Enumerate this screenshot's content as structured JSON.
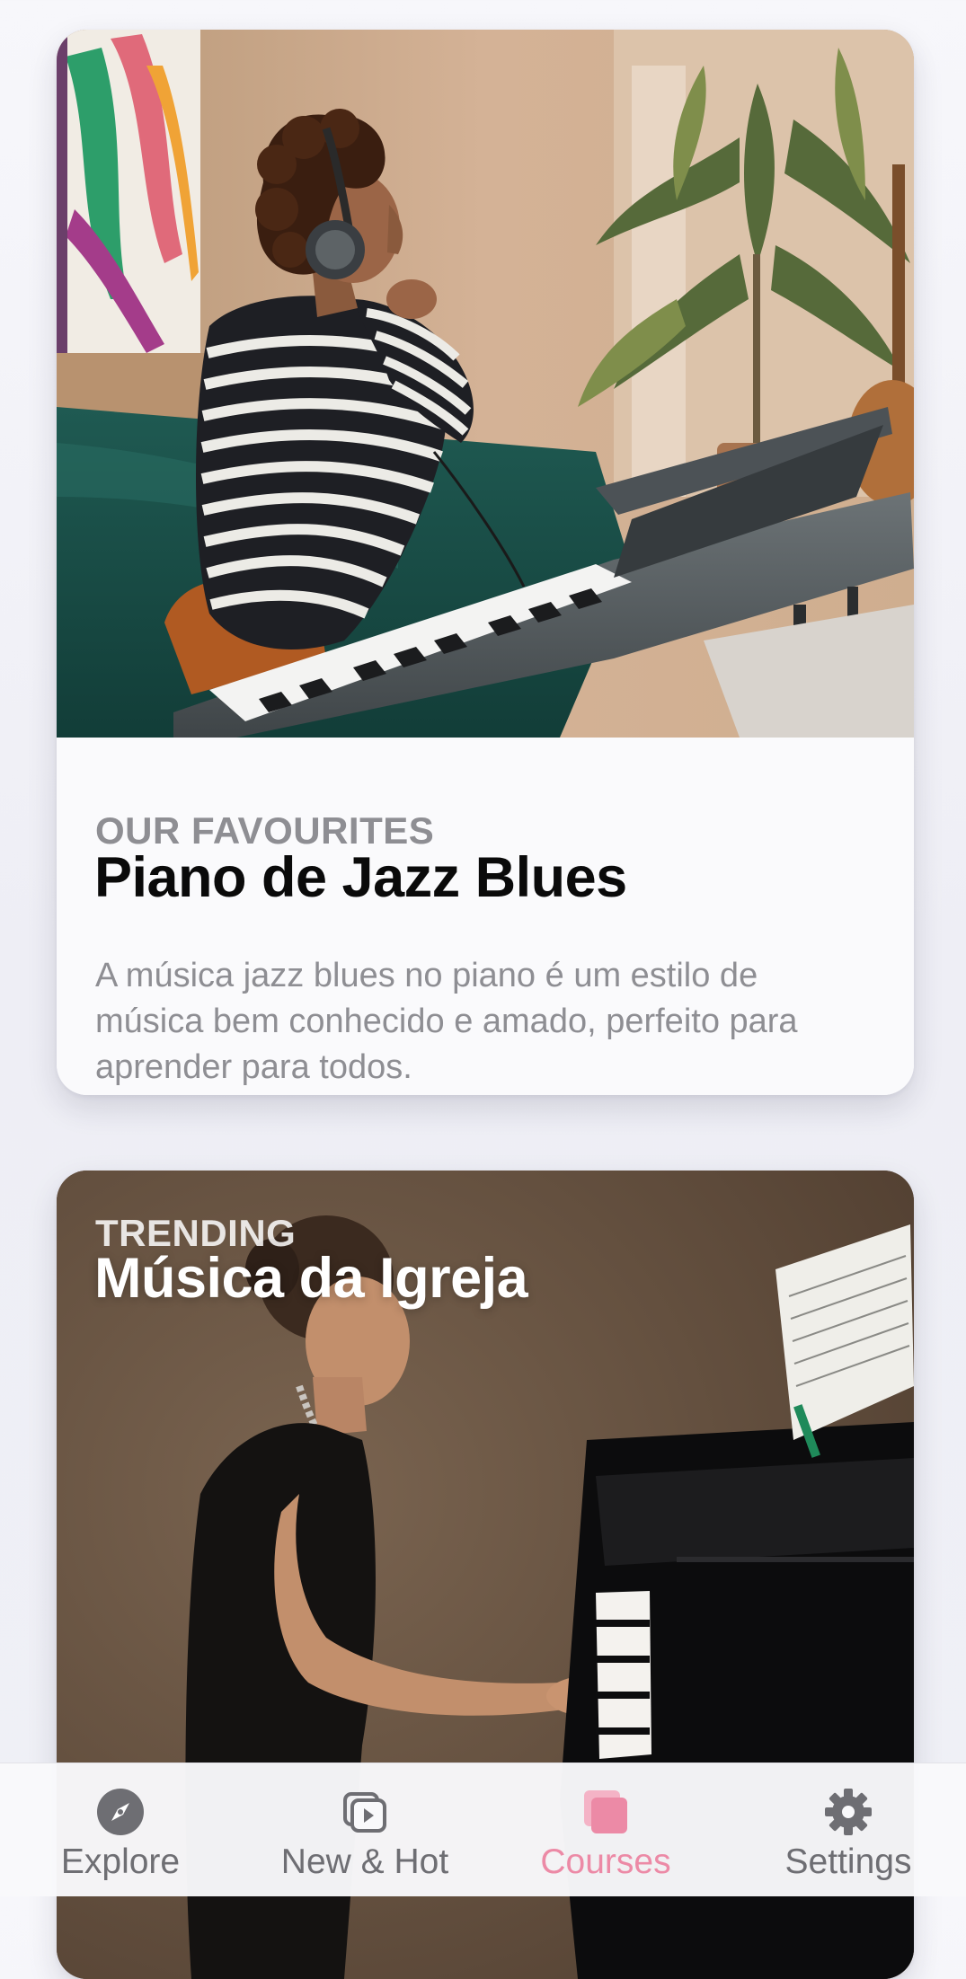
{
  "cards": [
    {
      "eyebrow": "OUR FAVOURITES",
      "title": "Piano de Jazz Blues",
      "description": "A música jazz blues no piano é um estilo de música bem conhecido e amado, perfeito para aprender para todos."
    },
    {
      "eyebrow": "TRENDING",
      "title": "Música da Igreja"
    }
  ],
  "tabbar": {
    "items": [
      {
        "label": "Explore",
        "icon": "compass-icon"
      },
      {
        "label": "New & Hot",
        "icon": "play-stack-icon"
      },
      {
        "label": "Courses",
        "icon": "stacked-squares-icon"
      },
      {
        "label": "Settings",
        "icon": "gear-icon"
      }
    ],
    "active": "Courses"
  },
  "colors": {
    "accent": "#ec8aa6",
    "inactive_tab": "#6e6e73",
    "eyebrow_gray": "#8e8e93",
    "title_dark": "#0a0a0a",
    "card_bg": "#fafafc",
    "page_bg": "#f2f2f7"
  }
}
